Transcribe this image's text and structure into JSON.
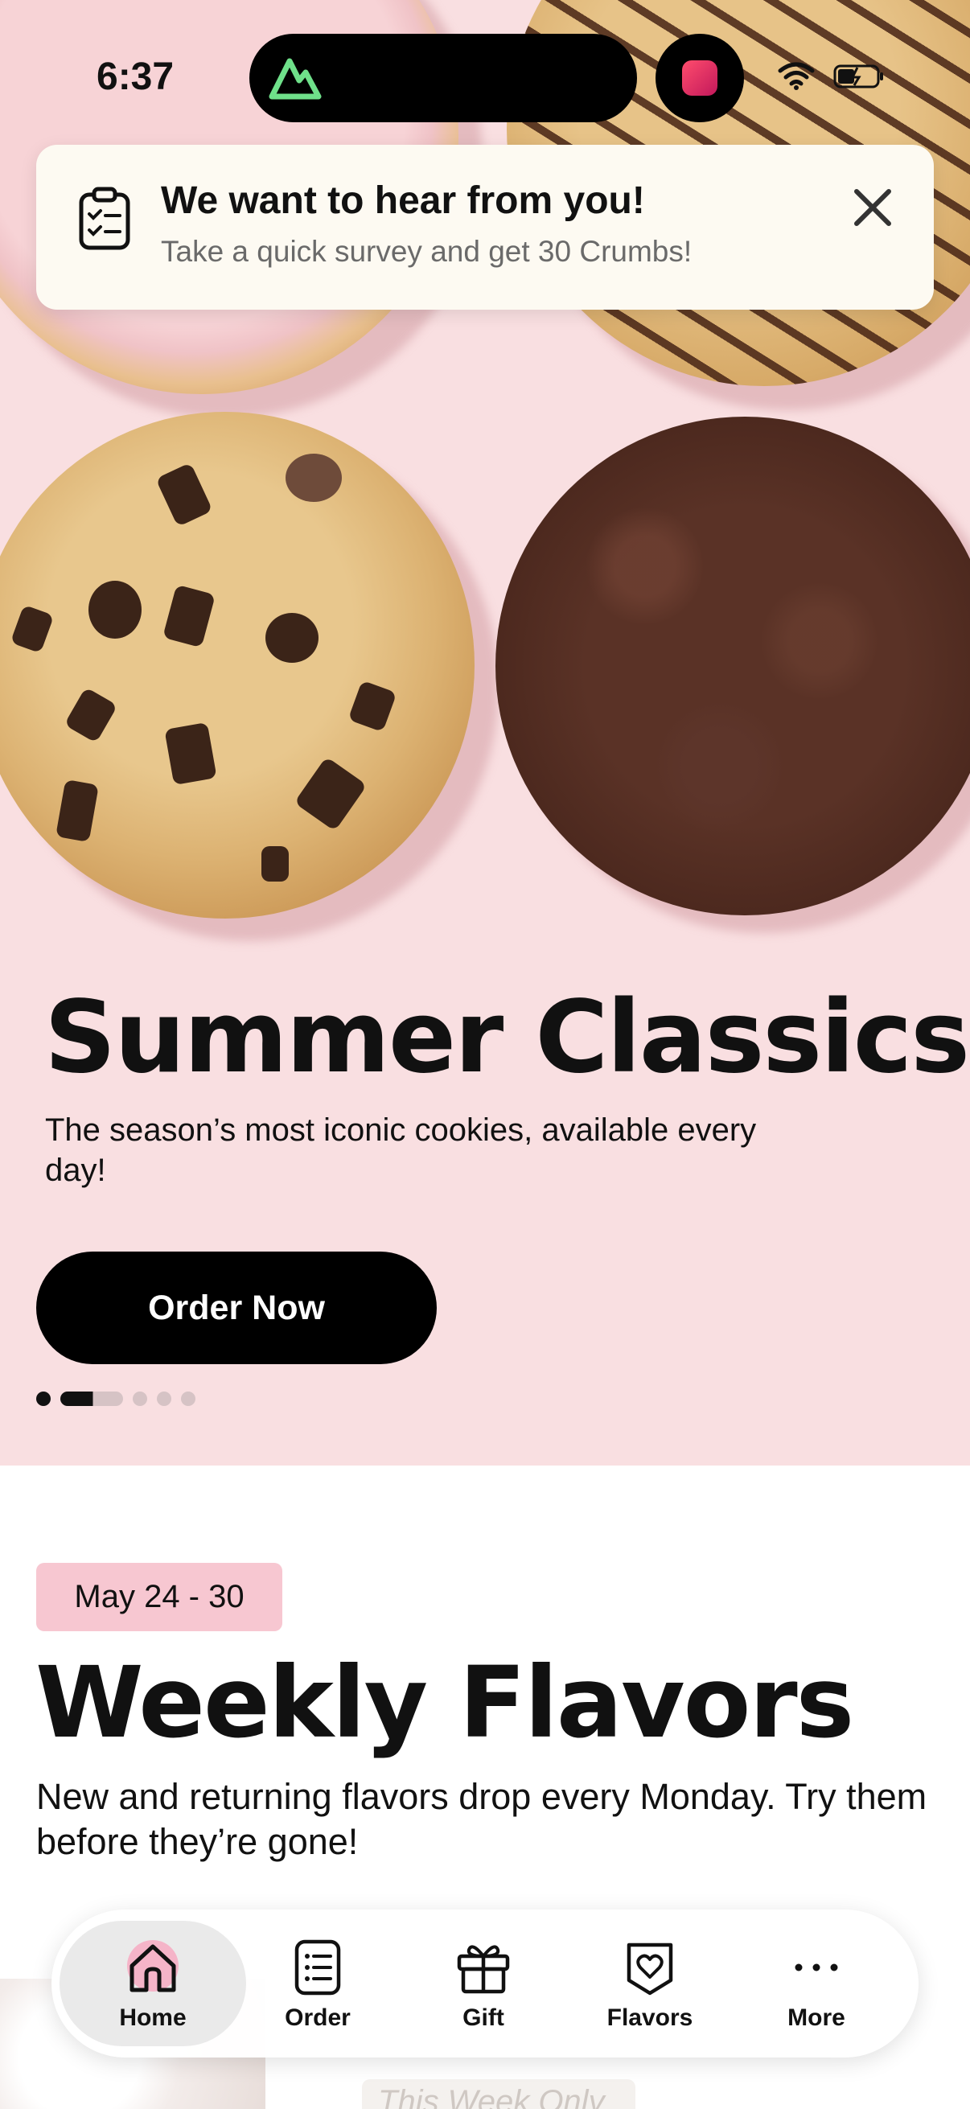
{
  "status_bar": {
    "time": "6:37"
  },
  "survey_banner": {
    "title": "We want to hear from you!",
    "subtitle": "Take a quick survey and get 30 Crumbs!"
  },
  "hero": {
    "title": "Summer Classics",
    "subtitle": "The season’s most iconic cookies, available every day!",
    "cta_label": "Order Now",
    "carousel": {
      "total_slides": 6,
      "current_slide": 2
    }
  },
  "weekly": {
    "date_badge": "May 24 - 30",
    "title": "Weekly Flavors",
    "subtitle": "New and returning flavors drop every Monday. Try them before they’re gone!",
    "peek_label": "This Week Only"
  },
  "tabbar": {
    "items": [
      {
        "label": "Home",
        "icon": "home-icon",
        "active": true
      },
      {
        "label": "Order",
        "icon": "order-list-icon",
        "active": false
      },
      {
        "label": "Gift",
        "icon": "gift-icon",
        "active": false
      },
      {
        "label": "Flavors",
        "icon": "heart-badge-icon",
        "active": false
      },
      {
        "label": "More",
        "icon": "more-dots-icon",
        "active": false
      }
    ]
  },
  "colors": {
    "hero_background": "#f9dfe1",
    "badge_pink": "#f7c7d1",
    "home_highlight": "#f5b4c8",
    "island_logo_green": "#6fe08a"
  }
}
